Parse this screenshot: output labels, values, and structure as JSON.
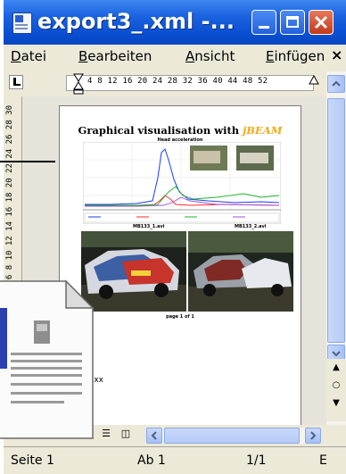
{
  "window": {
    "title": "export3_.xml -...",
    "buttons": {
      "minimize": "minimize",
      "maximize": "maximize",
      "close": "close"
    }
  },
  "menu": {
    "items": [
      {
        "label_u": "D",
        "label_rest": "atei"
      },
      {
        "label_u": "B",
        "label_rest": "earbeiten"
      },
      {
        "label_u": "A",
        "label_rest": "nsicht"
      },
      {
        "label_u": "E",
        "label_rest": "infügen"
      }
    ],
    "close_glyph": "×"
  },
  "ruler": {
    "tab_selector": "L",
    "numbers": "4 8 12 16 20 24 28 32 36 40 44 48 52",
    "vertical_numbers": "2 4 6 8 10 12 14 16 18 20 22 24 26 28 30"
  },
  "page": {
    "title_prefix": "Graphical visualisation with ",
    "title_brand": "jBEAM",
    "chart_subtitle": "Head acceleration",
    "caption_left": "MB133_1.avi",
    "caption_right": "MB133_2.avi",
    "footer": "page 1 of 1",
    "side_text": "xxx"
  },
  "chart_data": {
    "type": "line",
    "title": "Head acceleration",
    "series_count": 4,
    "colors": [
      "#1a3cff",
      "#ff2a2a",
      "#1fb52a",
      "#a04fd0"
    ]
  },
  "statusbar": {
    "page": "Seite 1",
    "section": "Ab 1",
    "pages": "1/1",
    "extra": "E"
  },
  "colors": {
    "titlebar": "#0a4fd2",
    "close_button": "#c3391b",
    "chrome": "#ece9d8"
  }
}
